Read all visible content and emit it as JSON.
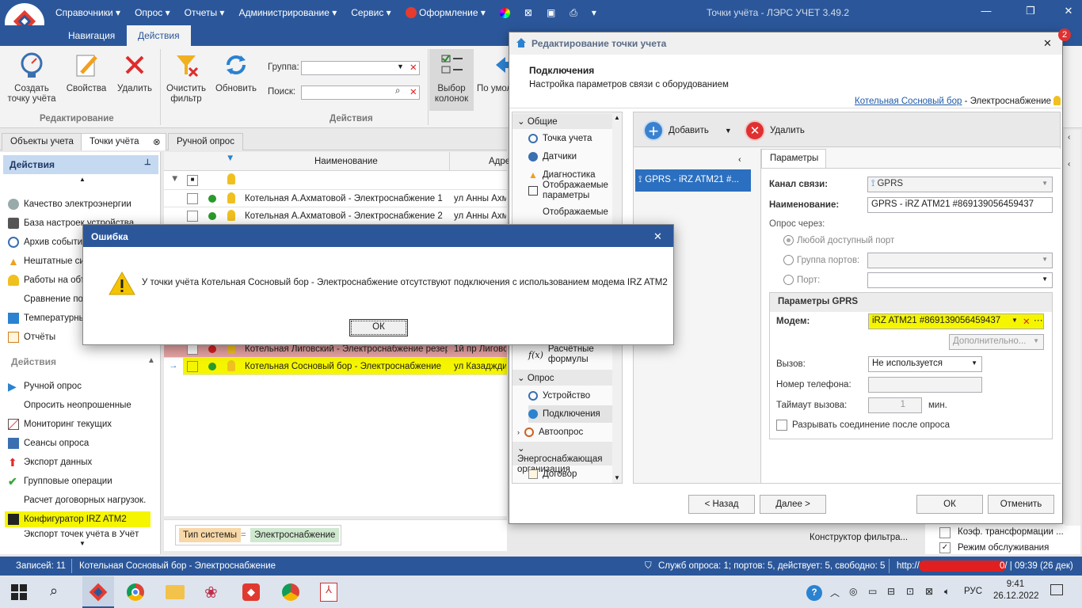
{
  "app": {
    "title": "Точки учёта - ЛЭРС УЧЕТ 3.49.2",
    "menu": [
      "Справочники",
      "Опрос",
      "Отчеты",
      "Администрирование",
      "Сервис",
      "Оформление"
    ],
    "notify_count": "2"
  },
  "ribbon": {
    "tabs": [
      "Навигация",
      "Действия"
    ],
    "buttons": {
      "create": "Создать точку учёта",
      "properties": "Свойства",
      "delete": "Удалить",
      "clear_filter": "Очистить фильтр",
      "refresh": "Обновить",
      "columns": "Выбор колонок",
      "default": "По умол"
    },
    "groups": {
      "edit": "Редактирование",
      "actions": "Действия"
    },
    "group_label": "Группа:",
    "search_label": "Поиск:"
  },
  "doc_tabs": [
    "Объекты учета",
    "Точки учёта",
    "Ручной опрос"
  ],
  "left_panel": {
    "header": "Действия",
    "items_top": [
      "Качество электроэнергии",
      "База настроек устройства",
      "Архив событий",
      "Нештатные ситуации",
      "Работы на объектах",
      "Сравнение показаний",
      "Температурный график",
      "Отчёты"
    ],
    "section": "Действия",
    "items_bottom": [
      "Ручной опрос",
      "Опросить неопрошенные",
      "Мониторинг текущих",
      "Сеансы опроса",
      "Экспорт данных",
      "Групповые операции",
      "Расчет договорных нагрузок.",
      "Конфигуратор IRZ ATM2",
      "Экспорт точек учёта в Учёт"
    ]
  },
  "grid": {
    "headers": {
      "name": "Наименование",
      "address": "Адрес"
    },
    "rows": [
      {
        "name": "Котельная А.Ахматовой - Электроснабжение 1",
        "address": "ул  Анны Ахматовой",
        "status": "green"
      },
      {
        "name": "Котельная А.Ахматовой - Электроснабжение 2",
        "address": "ул  Анны Ахматовой",
        "status": "green"
      },
      {
        "name": "Котельная Лиговский - Электроснабжение резерв",
        "address": "1й пр Лиговский",
        "status": "red"
      },
      {
        "name": "Котельная Сосновый бор - Электроснабжение",
        "address": "ул Казадждиева",
        "status": "red"
      }
    ]
  },
  "filter": {
    "field": "Тип системы",
    "op": "=",
    "value": "Электроснабжение",
    "constructor": "Конструктор фильтра..."
  },
  "status": {
    "records": "Записей: 11",
    "current": "Котельная Сосновый бор - Электроснабжение",
    "service": "Служб опроса: 1; портов: 5, действует: 5, свободно: 5",
    "url": "http://",
    "time": "0/ | 09:39 (26 дек)"
  },
  "editor": {
    "title": "Редактирование точки учета",
    "section_title": "Подключения",
    "section_desc": "Настройка параметров связи с оборудованием",
    "link": "Котельная Сосновый бор",
    "link_suffix": " - Электроснабжение",
    "nav": {
      "general": "Общие",
      "items1": [
        "Точка учета",
        "Датчики",
        "Диагностика",
        "Отображаемые параметры",
        "Отображаемые единицы"
      ],
      "formulas": "Расчётные формулы",
      "poll": "Опрос",
      "items2": [
        "Устройство",
        "Подключения",
        "Автоопрос"
      ],
      "supplier": "Энергоснабжающая организация",
      "contract": "Договор"
    },
    "add": "Добавить",
    "remove": "Удалить",
    "connection_item": "GPRS - iRZ ATM21 #...",
    "params_tab": "Параметры",
    "channel_label": "Канал связи:",
    "channel_value": "GPRS",
    "name_label": "Наименование:",
    "name_value": "GPRS - iRZ ATM21 #869139056459437",
    "poll_via": "Опрос через:",
    "any_port": "Любой доступный порт",
    "port_group": "Группа портов:",
    "port": "Порт:",
    "gprs_header": "Параметры GPRS",
    "modem_label": "Модем:",
    "modem_value": "iRZ ATM21 #869139056459437",
    "extra": "Дополнительно...",
    "call_label": "Вызов:",
    "call_value": "Не используется",
    "phone_label": "Номер телефона:",
    "timeout_label": "Таймаут вызова:",
    "timeout_value": "1",
    "timeout_unit": "мин.",
    "disconnect": "Разрывать соединение после опроса",
    "back": "< Назад",
    "next": "Далее >",
    "ok": "ОК",
    "cancel": "Отменить"
  },
  "right_panel": {
    "item1": "Коэф. трансформации ...",
    "item2": "Режим обслуживания"
  },
  "error": {
    "title": "Ошибка",
    "message": "У точки учёта Котельная Сосновый бор - Электроснабжение отсутствуют подключения с использованием модема IRZ ATM2",
    "ok": "ОК"
  },
  "taskbar": {
    "lang": "РУС",
    "time": "9:41",
    "date": "26.12.2022"
  },
  "colors": {
    "accent": "#2b579a",
    "highlight": "#f5f500",
    "error_row": "#e8a3a3"
  }
}
